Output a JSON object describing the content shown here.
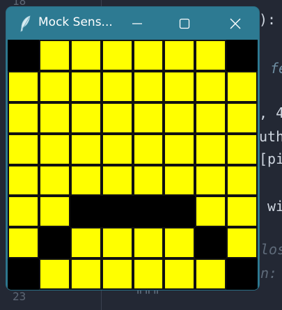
{
  "window": {
    "title": "Mock Sens...",
    "minimize_label": "Minimize",
    "maximize_label": "Maximize",
    "close_label": "Close"
  },
  "background_code": {
    "top_line_number": "18",
    "bottom_line_number": "23",
    "fragments": [
      "):",
      "fe",
      ", 4",
      "uth",
      "[pi",
      "wi",
      "los",
      "n:",
      "\"\"\""
    ]
  },
  "led_matrix": {
    "rows": 8,
    "cols": 8,
    "on_color": "#ffff00",
    "off_color": "#000000",
    "pixels": [
      [
        0,
        1,
        1,
        1,
        1,
        1,
        1,
        0
      ],
      [
        1,
        1,
        1,
        1,
        1,
        1,
        1,
        1
      ],
      [
        1,
        1,
        1,
        1,
        1,
        1,
        1,
        1
      ],
      [
        1,
        1,
        1,
        1,
        1,
        1,
        1,
        1
      ],
      [
        1,
        1,
        1,
        1,
        1,
        1,
        1,
        1
      ],
      [
        1,
        1,
        0,
        0,
        0,
        0,
        1,
        1
      ],
      [
        1,
        0,
        1,
        1,
        1,
        1,
        0,
        1
      ],
      [
        0,
        1,
        1,
        1,
        1,
        1,
        1,
        0
      ]
    ]
  },
  "colors": {
    "titlebar": "#2d7a92",
    "editor_background": "#232834"
  }
}
